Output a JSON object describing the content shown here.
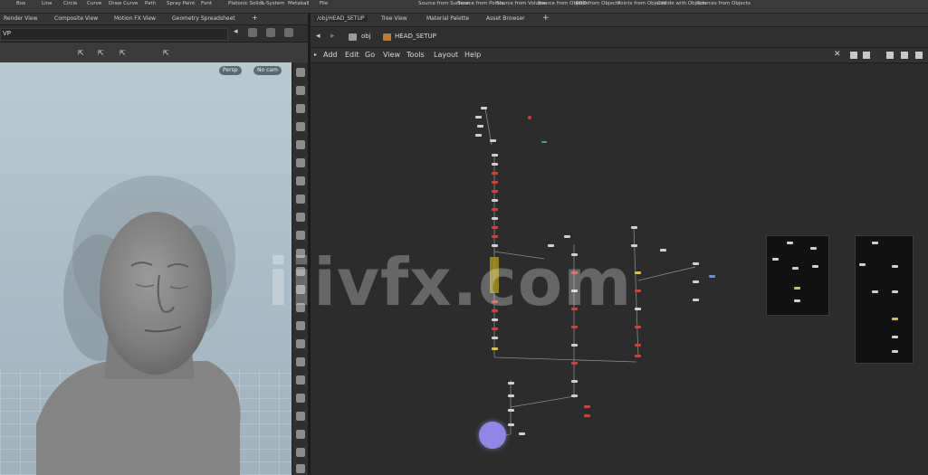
{
  "shelf": {
    "left_items": [
      "Box",
      "Line",
      "Circle",
      "Curve",
      "Draw Curve",
      "Path",
      "Spray Paint",
      "Font",
      "Platonic Solids",
      "L-System",
      "Metaball",
      "File"
    ],
    "right_items": [
      "Source from Surface",
      "Source from Points",
      "Source from Volume",
      "Source from Objects",
      "RBD from Objects",
      "Points from Objects",
      "Collide with Objects",
      "Sources from Objects"
    ]
  },
  "left_pane": {
    "tabs": [
      "Render View",
      "Composite View",
      "Motion FX View",
      "Geometry Spreadsheet"
    ],
    "path": "VP",
    "viewport_pills": [
      "Persp",
      "No cam"
    ]
  },
  "right_pane": {
    "tabs": [
      "/obj/HEAD_SETUP",
      "Tree View",
      "Material Palette",
      "Asset Browser"
    ],
    "path_root": "obj",
    "path_node": "HEAD_SETUP",
    "menu": [
      "Add",
      "Edit",
      "Go",
      "View",
      "Tools",
      "Layout",
      "Help"
    ]
  },
  "watermark": "iiivfx.com",
  "colors": {
    "node_gray": "#d0d0d0",
    "node_red": "#c8443c",
    "node_yellow": "#d6c04a",
    "node_blue": "#6a8ed8",
    "selection": "#b79a1a",
    "null_node": "#8f86e6"
  }
}
